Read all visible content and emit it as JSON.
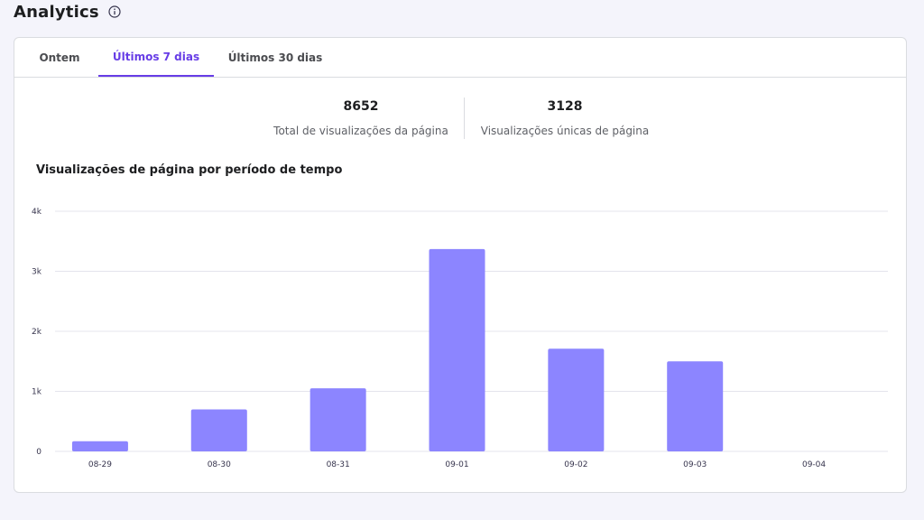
{
  "header": {
    "title": "Analytics",
    "info_icon": "info-circle-icon"
  },
  "tabs": [
    {
      "label": "Ontem",
      "active": false
    },
    {
      "label": "Últimos 7 dias",
      "active": true
    },
    {
      "label": "Últimos 30 dias",
      "active": false
    }
  ],
  "stats": [
    {
      "value": "8652",
      "label": "Total de visualizações da página"
    },
    {
      "value": "3128",
      "label": "Visualizações únicas de página"
    }
  ],
  "colors": {
    "accent": "#673de6",
    "bar": "#8c85ff"
  },
  "chart_data": {
    "type": "bar",
    "title": "Visualizações de página por período de tempo",
    "categories": [
      "08-29",
      "08-30",
      "08-31",
      "09-01",
      "09-02",
      "09-03",
      "09-04"
    ],
    "values": [
      170,
      700,
      1050,
      3370,
      1710,
      1500,
      0
    ],
    "ylim": [
      0,
      4000
    ],
    "yticks": [
      0,
      1000,
      2000,
      3000,
      4000
    ],
    "ytick_labels": [
      "0",
      "1k",
      "2k",
      "3k",
      "4k"
    ],
    "grid": true,
    "xlabel": "",
    "ylabel": ""
  }
}
